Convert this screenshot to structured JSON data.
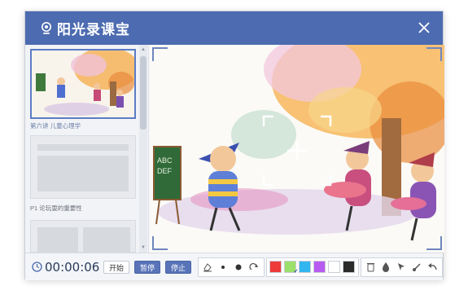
{
  "app": {
    "title": "阳光录课宝"
  },
  "sidebar": {
    "slides": [
      {
        "caption": "第六讲  儿童心理学"
      },
      {
        "caption": "P1  论玩耍的重要性"
      }
    ]
  },
  "toolbar": {
    "timer": "00:00:06",
    "start_label": "开始",
    "pause_label": "暂停",
    "stop_label": "停止"
  },
  "colors": {
    "brand": "#4c6bb0",
    "palette": [
      "#ee3a3a",
      "#9be06a",
      "#31b6ef",
      "#b85bf0",
      "#ffffff",
      "#2b2b2b"
    ]
  }
}
